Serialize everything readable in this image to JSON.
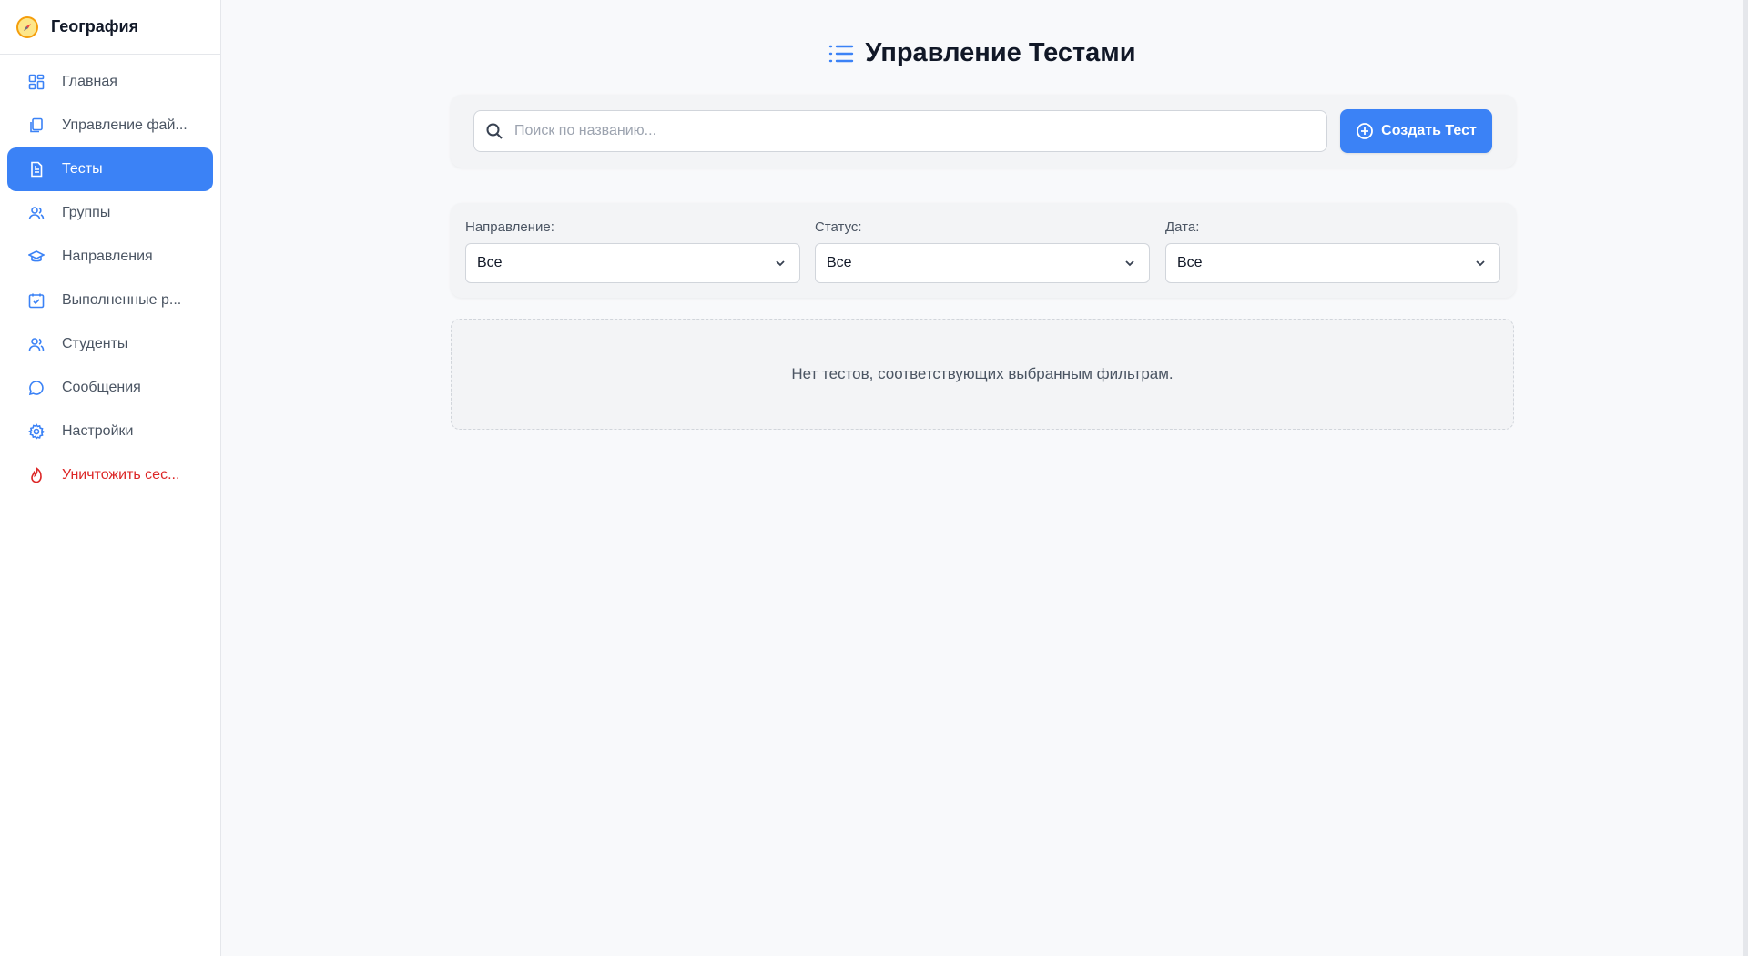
{
  "brand": {
    "title": "География",
    "icon": "compass-icon"
  },
  "sidebar": {
    "items": [
      {
        "label": "Главная",
        "icon": "dashboard-icon"
      },
      {
        "label": "Управление фай...",
        "icon": "files-icon"
      },
      {
        "label": "Тесты",
        "icon": "document-icon",
        "active": true
      },
      {
        "label": "Группы",
        "icon": "users-icon"
      },
      {
        "label": "Направления",
        "icon": "graduation-cap-icon"
      },
      {
        "label": "Выполненные р...",
        "icon": "calendar-check-icon"
      },
      {
        "label": "Студенты",
        "icon": "students-icon"
      },
      {
        "label": "Сообщения",
        "icon": "chat-icon"
      },
      {
        "label": "Настройки",
        "icon": "gear-icon"
      },
      {
        "label": "Уничтожить сес...",
        "icon": "flame-icon",
        "danger": true
      }
    ]
  },
  "page": {
    "title": "Управление Тестами"
  },
  "search": {
    "placeholder": "Поиск по названию...",
    "value": ""
  },
  "create_button": {
    "label": "Создать Тест"
  },
  "filters": [
    {
      "label": "Направление:",
      "value": "Все"
    },
    {
      "label": "Статус:",
      "value": "Все"
    },
    {
      "label": "Дата:",
      "value": "Все"
    }
  ],
  "empty_state": {
    "message": "Нет тестов, соответствующих выбранным фильтрам."
  },
  "colors": {
    "accent": "#3b82f6",
    "danger": "#dc2626",
    "background": "#f8f9fb"
  }
}
